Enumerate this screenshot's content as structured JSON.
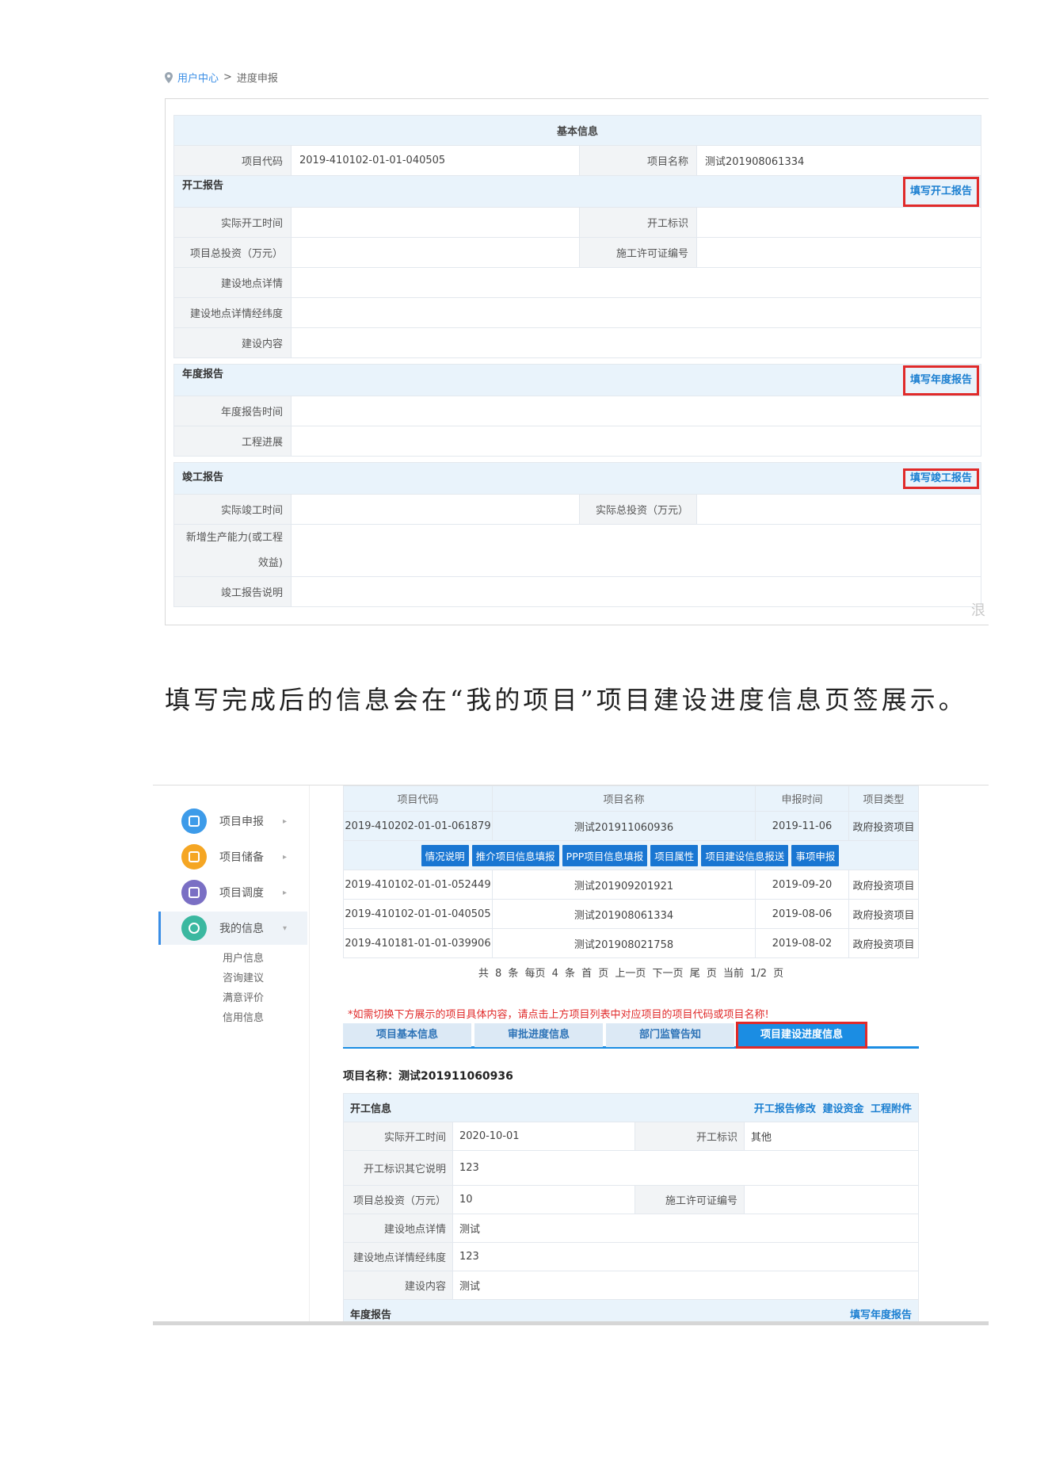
{
  "breadcrumb": {
    "home": "用户中心",
    "separator": ">",
    "current": "进度申报"
  },
  "form1": {
    "header": "基本信息",
    "project_code_label": "项目代码",
    "project_code": "2019-410102-01-01-040505",
    "project_name_label": "项目名称",
    "project_name": "测试201908061334",
    "start": {
      "title": "开工报告",
      "action": "填写开工报告",
      "actual_start_label": "实际开工时间",
      "start_flag_label": "开工标识",
      "total_invest_label": "项目总投资（万元）",
      "permit_label": "施工许可证编号",
      "site_detail_label": "建设地点详情",
      "site_geo_label": "建设地点详情经纬度",
      "content_label": "建设内容"
    },
    "annual": {
      "title": "年度报告",
      "action": "填写年度报告",
      "report_time_label": "年度报告时间",
      "progress_label": "工程进展"
    },
    "completion": {
      "title": "竣工报告",
      "action": "填写竣工报告",
      "actual_end_label": "实际竣工时间",
      "actual_invest_label": "实际总投资（万元）",
      "capacity_label_1": "新增生产能力(或工程",
      "capacity_label_2": "效益)",
      "note_label": "竣工报告说明"
    },
    "edge_char": "泿"
  },
  "caption": "填写完成后的信息会在“我的项目”项目建设进度信息页签展示。",
  "sidebar": {
    "items": [
      {
        "label": "项目申报",
        "color": "#3d9be9"
      },
      {
        "label": "项目储备",
        "color": "#f5a623"
      },
      {
        "label": "项目调度",
        "color": "#7a6fc4"
      },
      {
        "label": "我的信息",
        "color": "#3bb8a0"
      }
    ],
    "arrow_right": "▸",
    "arrow_down": "▾",
    "sub_items": [
      "用户信息",
      "咨询建议",
      "满意评价",
      "信用信息"
    ]
  },
  "projects": {
    "headers": [
      "项目代码",
      "项目名称",
      "申报时间",
      "项目类型"
    ],
    "rows": [
      [
        "2019-410202-01-01-061879",
        "测试201911060936",
        "2019-11-06",
        "政府投资项目"
      ],
      [
        "2019-410102-01-01-052449",
        "测试201909201921",
        "2019-09-20",
        "政府投资项目"
      ],
      [
        "2019-410102-01-01-040505",
        "测试201908061334",
        "2019-08-06",
        "政府投资项目"
      ],
      [
        "2019-410181-01-01-039906",
        "测试201908021758",
        "2019-08-02",
        "政府投资项目"
      ]
    ],
    "buttons": [
      "情况说明",
      "推介项目信息填报",
      "PPP项目信息填报",
      "项目属性",
      "项目建设信息报送",
      "事项申报"
    ]
  },
  "pager": "共 8 条  每页 4 条  首 页  上一页   下一页    尾 页   当前 1/2 页",
  "warning": "*如需切换下方展示的项目具体内容，请点击上方项目列表中对应项目的项目代码或项目名称!",
  "tabs": [
    "项目基本信息",
    "审批进度信息",
    "部门监管告知",
    "项目建设进度信息"
  ],
  "project_title": "项目名称：测试201911060936",
  "form2": {
    "section": "开工信息",
    "links": [
      "开工报告修改",
      "建设资金",
      "工程附件"
    ],
    "actual_start_label": "实际开工时间",
    "actual_start": "2020-10-01",
    "start_flag_label": "开工标识",
    "start_flag": "其他",
    "flag_note_label": "开工标识其它说明",
    "flag_note": "123",
    "total_invest_label": "项目总投资（万元）",
    "total_invest": "10",
    "permit_label": "施工许可证编号",
    "site_detail_label": "建设地点详情",
    "site_detail": "测试",
    "site_geo_label": "建设地点详情经纬度",
    "site_geo": "123",
    "content_label": "建设内容",
    "content": "测试",
    "annual_title": "年度报告",
    "annual_action": "填写年度报告"
  }
}
